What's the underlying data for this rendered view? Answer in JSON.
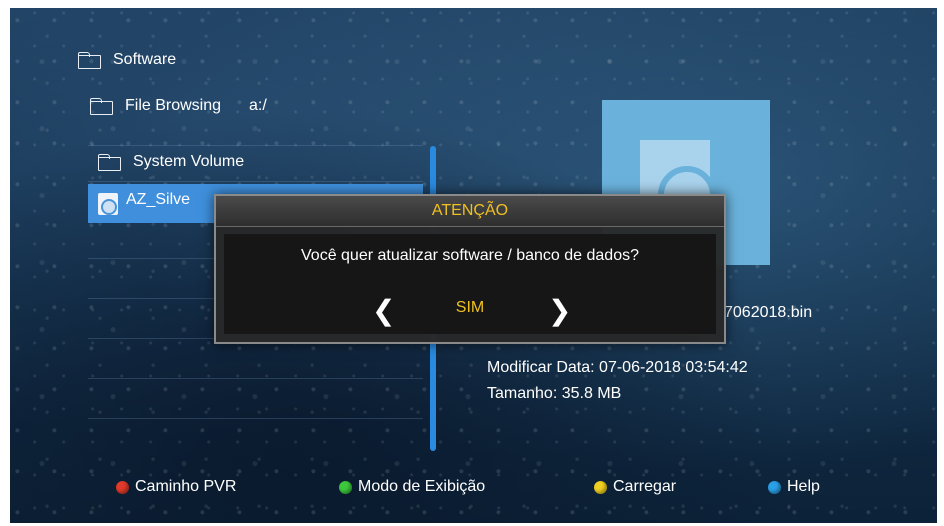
{
  "breadcrumb": {
    "root": "Software",
    "browse_label": "File Browsing",
    "path": "a:/"
  },
  "list": {
    "items": [
      "System Volume"
    ],
    "selected": "AZ_Silve"
  },
  "info": {
    "filename_fragment": "7062018.bin",
    "modified": "Modificar Data: 07-06-2018 03:54:42",
    "size": "Tamanho: 35.8 MB"
  },
  "dialog": {
    "title": "ATENÇÃO",
    "message": "Você quer atualizar software / banco de dados?",
    "option": "SIM",
    "prev_glyph": "❮",
    "next_glyph": "❯"
  },
  "footer": {
    "red": "Caminho PVR",
    "green": "Modo de Exibição",
    "yellow": "Carregar",
    "blue": "Help"
  },
  "colors": {
    "accent": "#3f8fdc",
    "highlight": "#f0c020",
    "red": "#e03a2a",
    "green": "#3cc83c",
    "yellow": "#f0d020",
    "blue": "#2aa0e8"
  },
  "icons": {
    "folder": "folder-icon",
    "disc": "disc-file-icon",
    "preview": "preview-image-icon"
  }
}
